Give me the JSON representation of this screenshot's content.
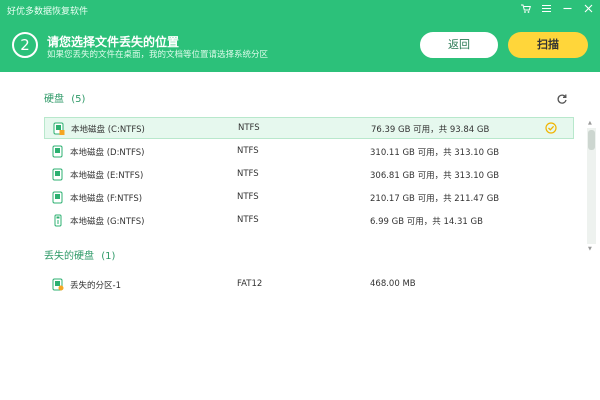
{
  "app": {
    "title": "好优多数据恢复软件"
  },
  "header": {
    "step_number": "2",
    "title": "请您选择文件丢失的位置",
    "subtitle": "如果您丢失的文件在桌面，我的文档等位置请选择系统分区",
    "back_label": "返回",
    "scan_label": "扫描"
  },
  "colors": {
    "header_green": "#2cc17a",
    "scan_yellow": "#ffd63a",
    "section_green": "#2f9a68"
  },
  "sections": {
    "disks": {
      "title": "硬盘",
      "count": "(5)",
      "items": [
        {
          "name": "本地磁盘 (C:NTFS)",
          "fs": "NTFS",
          "capacity": "76.39 GB 可用，共 93.84 GB",
          "selected": true,
          "icon": "disk-windows-icon"
        },
        {
          "name": "本地磁盘 (D:NTFS)",
          "fs": "NTFS",
          "capacity": "310.11 GB 可用，共 313.10 GB",
          "selected": false,
          "icon": "disk-icon"
        },
        {
          "name": "本地磁盘 (E:NTFS)",
          "fs": "NTFS",
          "capacity": "306.81 GB 可用，共 313.10 GB",
          "selected": false,
          "icon": "disk-icon"
        },
        {
          "name": "本地磁盘 (F:NTFS)",
          "fs": "NTFS",
          "capacity": "210.17 GB 可用，共 211.47 GB",
          "selected": false,
          "icon": "disk-icon"
        },
        {
          "name": "本地磁盘 (G:NTFS)",
          "fs": "NTFS",
          "capacity": "6.99 GB 可用，共 14.31 GB",
          "selected": false,
          "icon": "usb-icon"
        }
      ]
    },
    "lost": {
      "title": "丢失的硬盘",
      "count": "(1)",
      "items": [
        {
          "name": "丢失的分区-1",
          "fs": "FAT12",
          "capacity": "468.00 MB",
          "selected": false,
          "icon": "lost-partition-icon"
        }
      ]
    }
  }
}
